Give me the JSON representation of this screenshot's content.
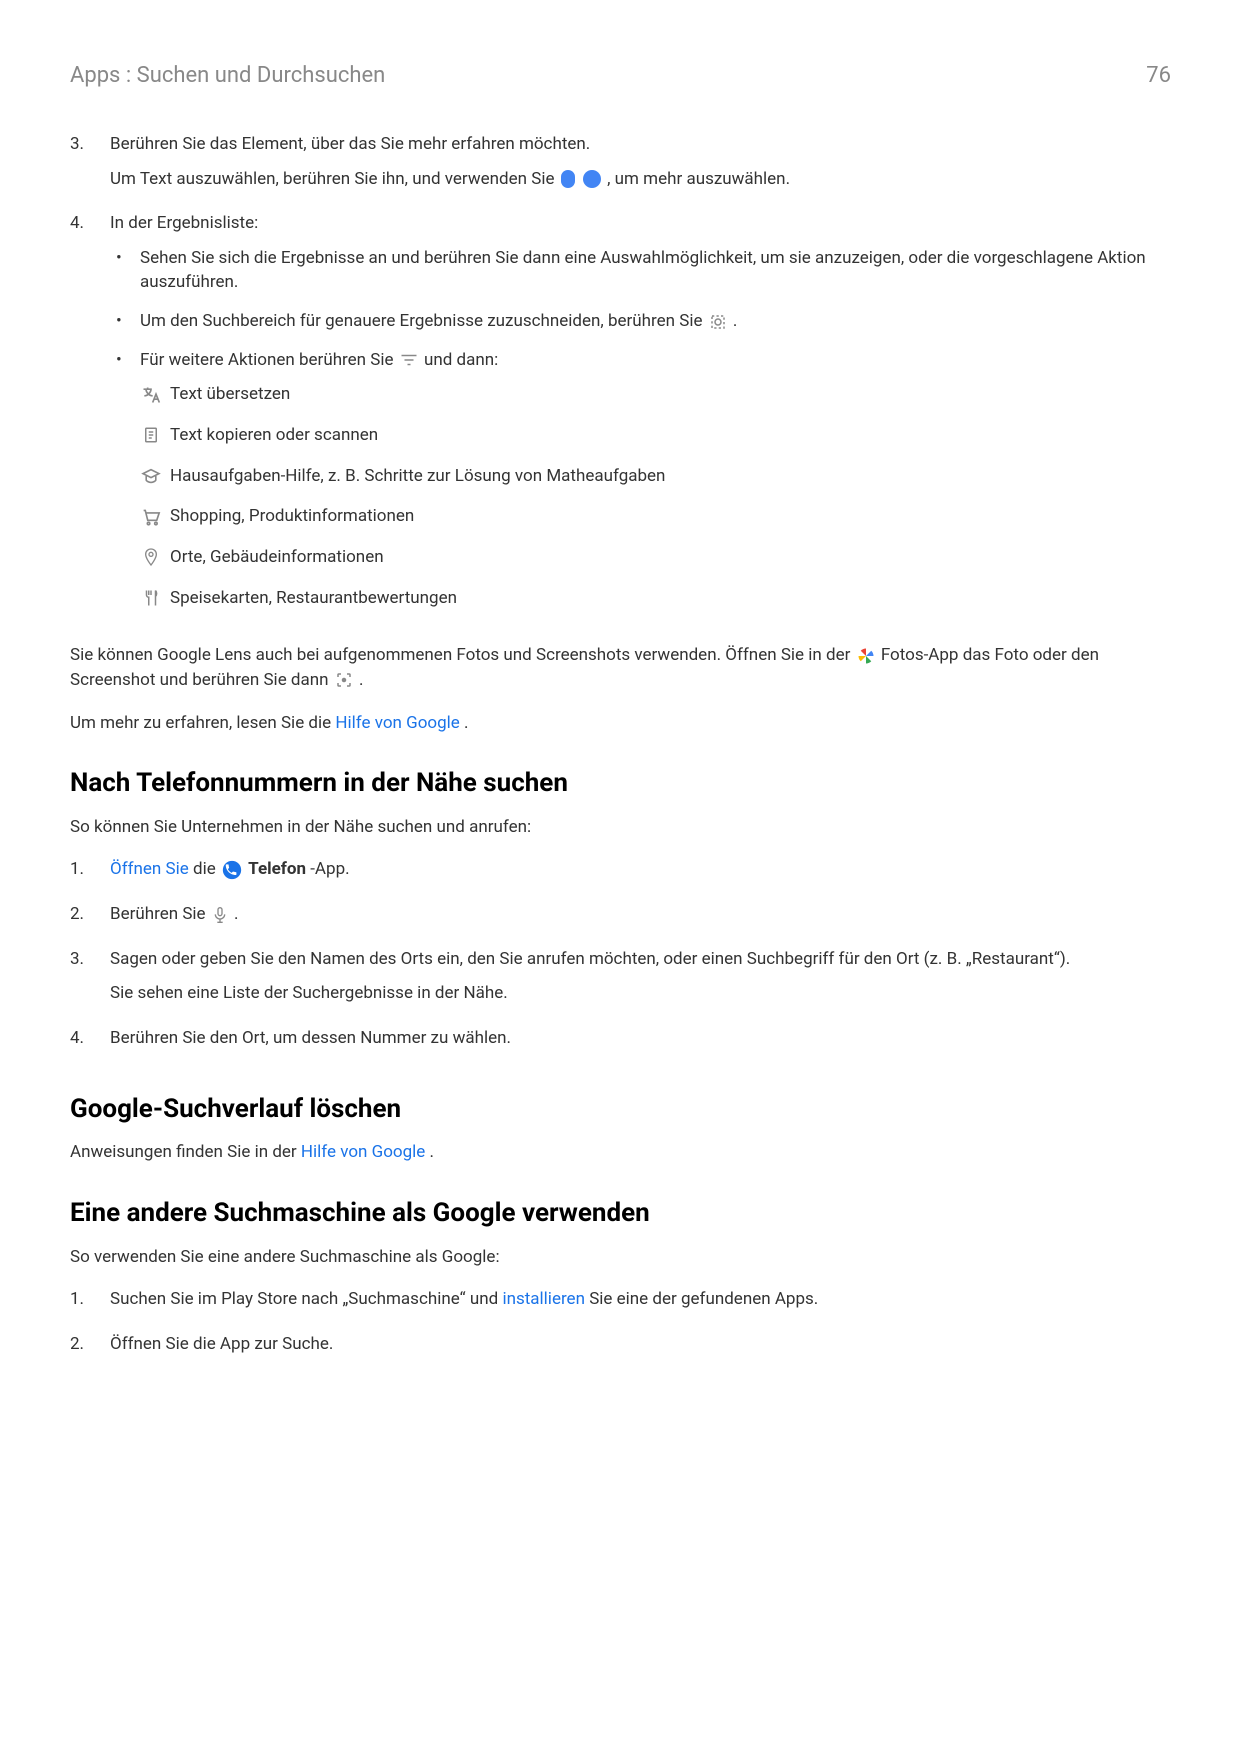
{
  "header": {
    "breadcrumb": "Apps : Suchen und Durchsuchen",
    "page": "76"
  },
  "step3": {
    "num": "3.",
    "line1": "Berühren Sie das Element, über das Sie mehr erfahren möchten.",
    "line2a": "Um Text auszuwählen, berühren Sie ihn, und verwenden Sie ",
    "line2b": ", um mehr auszuwählen."
  },
  "step4": {
    "num": "4.",
    "intro": "In der Ergebnisliste:",
    "b1": "Sehen Sie sich die Ergebnisse an und berühren Sie dann eine Auswahlmöglichkeit, um sie anzuzeigen, oder die vorgeschlagene Aktion auszuführen.",
    "b2a": "Um den Suchbereich für genauere Ergebnisse zuzuschneiden, berühren Sie ",
    "b2b": ".",
    "b3a": "Für weitere Aktionen berühren Sie ",
    "b3b": " und dann:",
    "icons": {
      "translate": "Text übersetzen",
      "copy": "Text kopieren oder scannen",
      "homework": "Hausaufgaben-Hilfe, z. B. Schritte zur Lösung von Matheaufgaben",
      "shopping": "Shopping, Produktinformationen",
      "places": "Orte, Gebäudeinformationen",
      "dining": "Speisekarten, Restaurantbewertungen"
    }
  },
  "lens_para_a": "Sie können Google Lens auch bei aufgenommenen Fotos und Screenshots verwenden. Öffnen Sie in der ",
  "lens_para_b": " Fotos-App das Foto oder den Screenshot und berühren Sie dann ",
  "lens_para_c": ".",
  "learn_more_a": "Um mehr zu erfahren, lesen Sie die ",
  "learn_more_link": "Hilfe von Google",
  "learn_more_b": ".",
  "h_phone": "Nach Telefonnummern in der Nähe suchen",
  "phone_intro": "So können Sie Unternehmen in der Nähe suchen und anrufen:",
  "phone_steps": {
    "s1_num": "1.",
    "s1_link": "Öffnen Sie",
    "s1_a": " die ",
    "s1_b": " ",
    "s1_app": "Telefon",
    "s1_c": "-App.",
    "s2_num": "2.",
    "s2_a": "Berühren Sie ",
    "s2_b": ".",
    "s3_num": "3.",
    "s3_a": "Sagen oder geben Sie den Namen des Orts ein, den Sie anrufen möchten, oder einen Suchbegriff für den Ort (z. B. „Restaurant“).",
    "s3_b": "Sie sehen eine Liste der Suchergebnisse in der Nähe.",
    "s4_num": "4.",
    "s4": "Berühren Sie den Ort, um dessen Nummer zu wählen."
  },
  "h_history": "Google-Suchverlauf löschen",
  "history_a": "Anweisungen finden Sie in der ",
  "history_link": "Hilfe von Google",
  "history_b": ".",
  "h_other": "Eine andere Suchmaschine als Google verwenden",
  "other_intro": "So verwenden Sie eine andere Suchmaschine als Google:",
  "other_steps": {
    "s1_num": "1.",
    "s1_a": "Suchen Sie im Play Store nach „Suchmaschine“ und ",
    "s1_link": "installieren",
    "s1_b": " Sie eine der gefundenen Apps.",
    "s2_num": "2.",
    "s2": "Öffnen Sie die App zur Suche."
  }
}
